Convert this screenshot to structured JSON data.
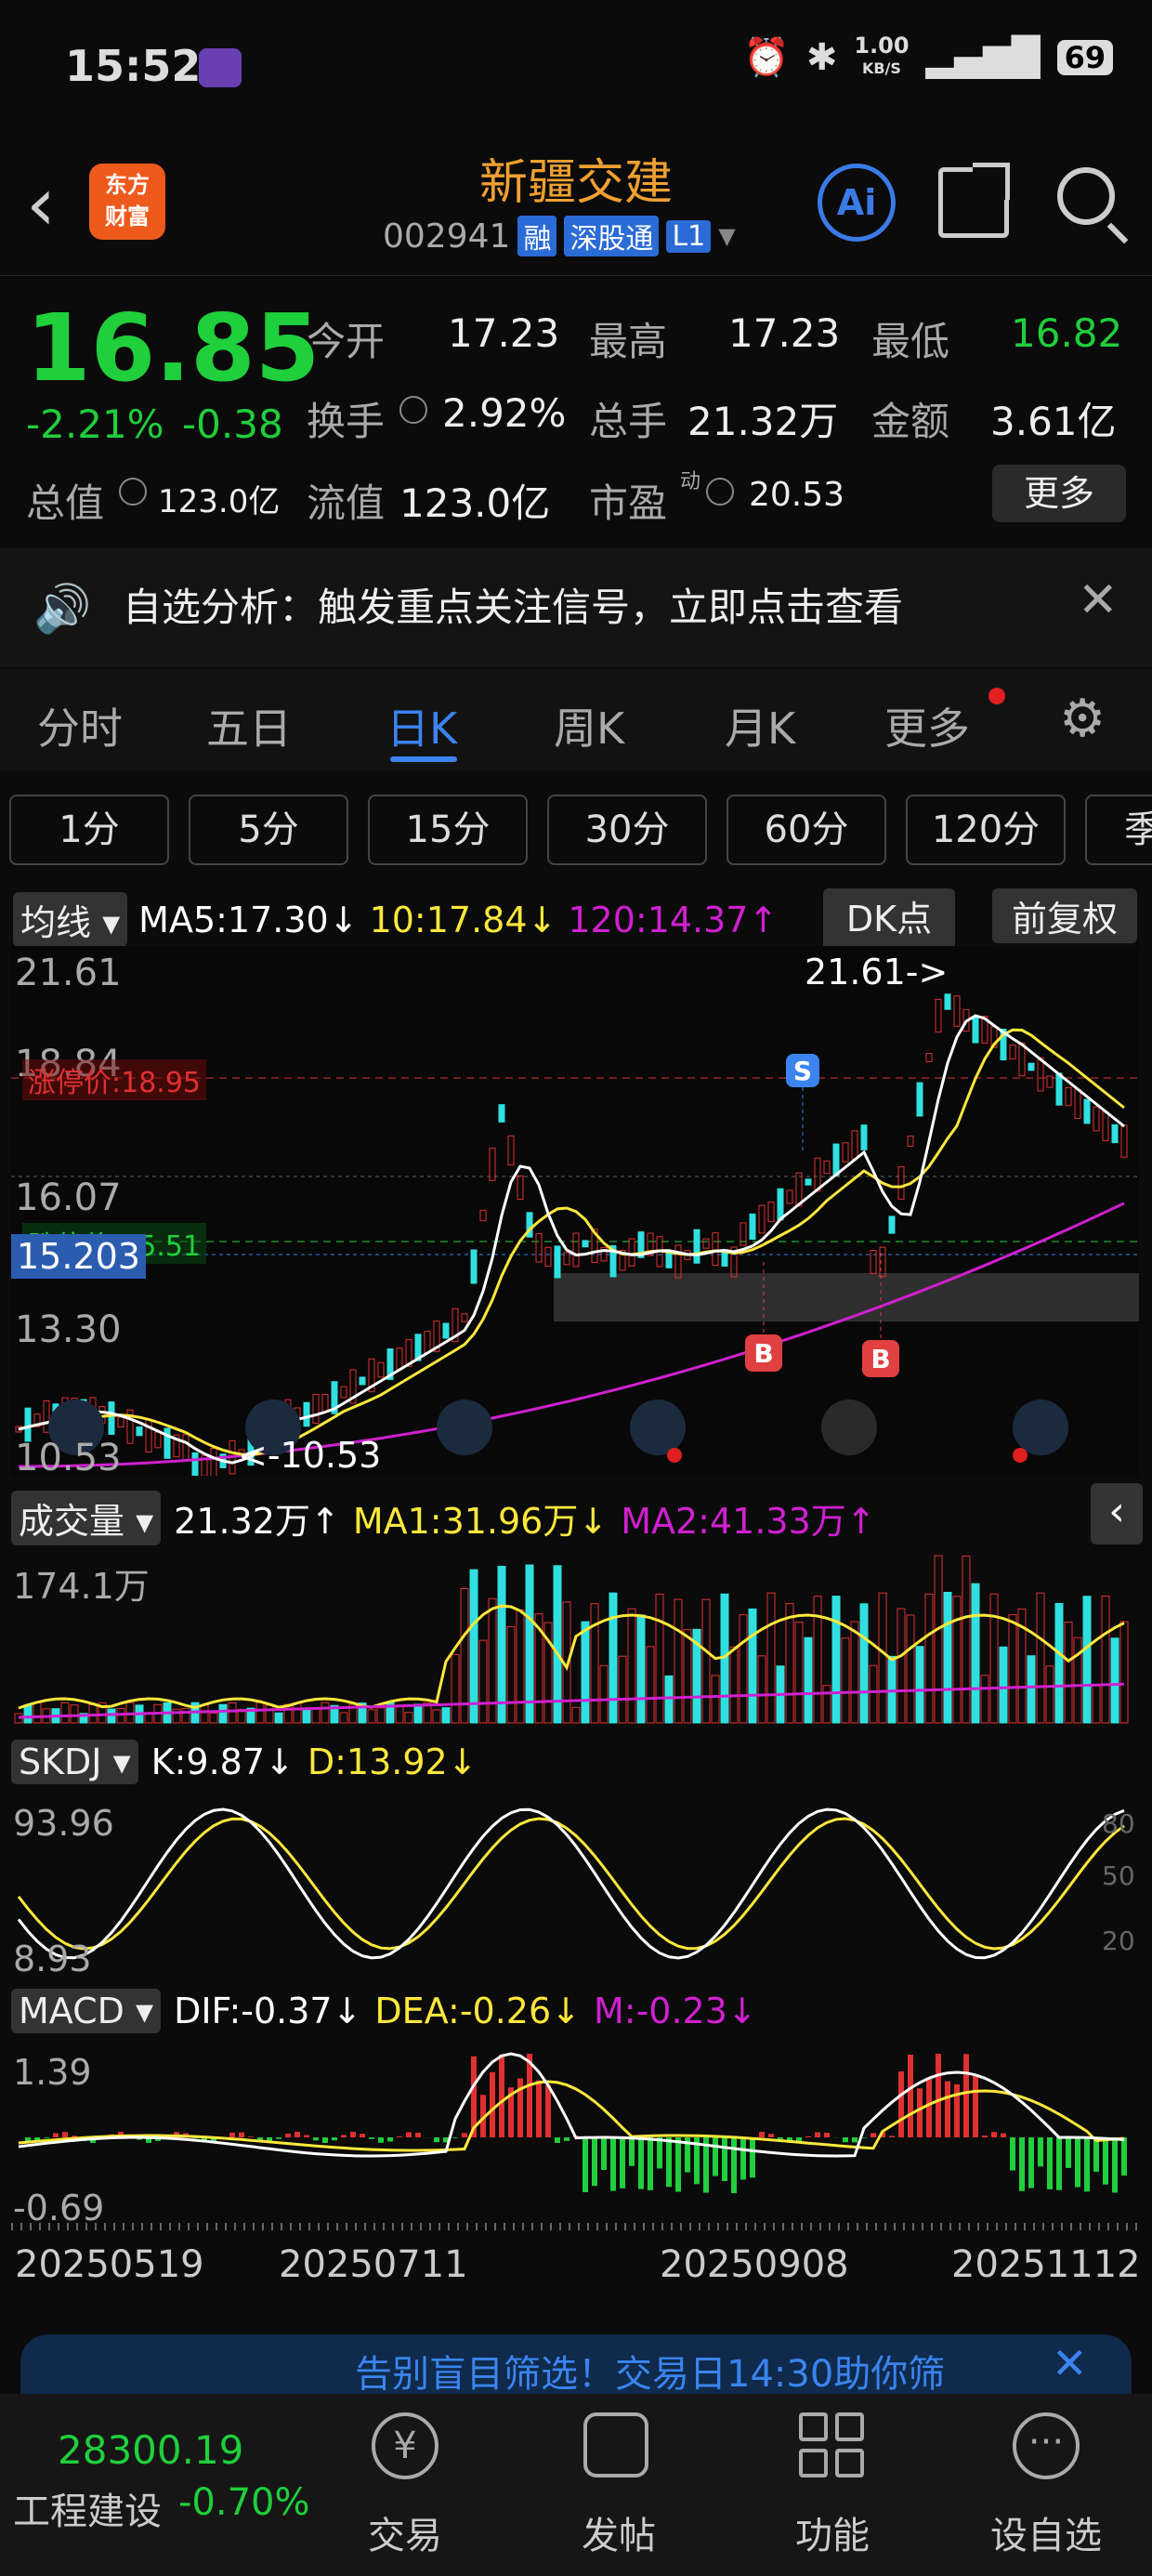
{
  "status": {
    "time": "15:52",
    "net_speed": "1.00",
    "net_unit": "KB/S",
    "battery": "69"
  },
  "header": {
    "title": "新疆交建",
    "code": "002941",
    "tags": [
      "融",
      "深股通",
      "L1"
    ],
    "logo_line1": "东方",
    "logo_line2": "财富",
    "ai_label": "Ai"
  },
  "quote": {
    "price": "16.85",
    "change_pct": "-2.21%",
    "change": "-0.38",
    "fields": [
      {
        "label": "今开",
        "value": "17.23"
      },
      {
        "label": "最高",
        "value": "17.23"
      },
      {
        "label": "最低",
        "value": "16.82"
      },
      {
        "label": "换手",
        "value": "2.92%"
      },
      {
        "label": "总手",
        "value": "21.32万"
      },
      {
        "label": "金额",
        "value": "3.61亿"
      },
      {
        "label": "总值",
        "value": "123.0亿"
      },
      {
        "label": "流值",
        "value": "123.0亿"
      },
      {
        "label": "市盈",
        "value": "20.53"
      }
    ],
    "pe_sup": "动",
    "more": "更多"
  },
  "notice": {
    "text": "自选分析：触发重点关注信号，立即点击查看"
  },
  "tabs": [
    "分时",
    "五日",
    "日K",
    "周K",
    "月K",
    "更多"
  ],
  "periods": [
    "1分",
    "5分",
    "15分",
    "30分",
    "60分",
    "120分",
    "季"
  ],
  "kline": {
    "ma_label": "均线",
    "ma5": "MA5:17.30",
    "ma10": "10:17.84",
    "ma120": "120:14.37",
    "dk": "DK点",
    "fq": "前复权",
    "y_labels": [
      "21.61",
      "18.84",
      "16.07",
      "13.30",
      "10.53"
    ],
    "high_label": "21.61->",
    "low_label": "<-10.53",
    "limit_up": "涨停价:18.95",
    "limit_down": "跌停价:15.51",
    "cursor": "15.203"
  },
  "volume": {
    "label": "成交量",
    "v": "21.32万",
    "ma1": "MA1:31.96万",
    "ma2": "MA2:41.33万",
    "max": "174.1万"
  },
  "skdj": {
    "label": "SKDJ",
    "k": "K:9.87",
    "d": "D:13.92",
    "top": "93.96",
    "bottom": "8.93",
    "levels": [
      "80",
      "50",
      "20"
    ]
  },
  "macd": {
    "label": "MACD",
    "dif": "DIF:-0.37",
    "dea": "DEA:-0.26",
    "m": "M:-0.23",
    "top": "1.39",
    "bottom": "-0.69"
  },
  "dates": [
    "20250519",
    "20250711",
    "20250908",
    "20251112"
  ],
  "banner": {
    "text": "告别盲目筛选！交易日14:30助你筛"
  },
  "bottom": {
    "index_value": "28300.19",
    "index_name": "工程建设",
    "index_chg": "-0.70%",
    "items": [
      "交易",
      "发帖",
      "功能",
      "设自选"
    ]
  },
  "colors": {
    "up": "#e03030",
    "down": "#1fcf3c",
    "accent": "#3b84ef",
    "ma5": "#ffffff",
    "ma10": "#ffe83b",
    "ma120": "#d020d0"
  }
}
